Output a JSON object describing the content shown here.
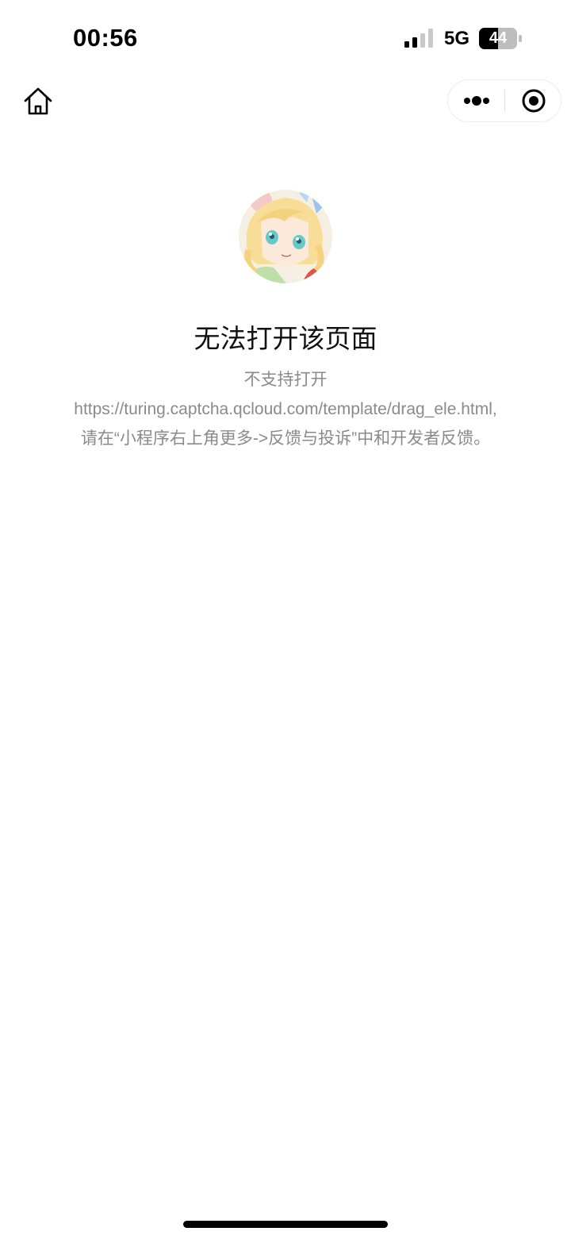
{
  "status_bar": {
    "time": "00:56",
    "network": "5G",
    "battery": "44"
  },
  "nav": {
    "home_icon": "home-icon",
    "more_icon": "more-dots-icon",
    "close_icon": "target-close-icon"
  },
  "content": {
    "avatar": "anime-avatar",
    "title": "无法打开该页面",
    "desc_line1": "不支持打开",
    "desc_line2": "https://turing.captcha.qcloud.com/template/drag_ele.html,",
    "desc_line3": "请在“小程序右上角更多->反馈与投诉”中和开发者反馈。"
  },
  "colors": {
    "title": "#111111",
    "desc": "#8a8a8a",
    "background": "#ffffff"
  }
}
